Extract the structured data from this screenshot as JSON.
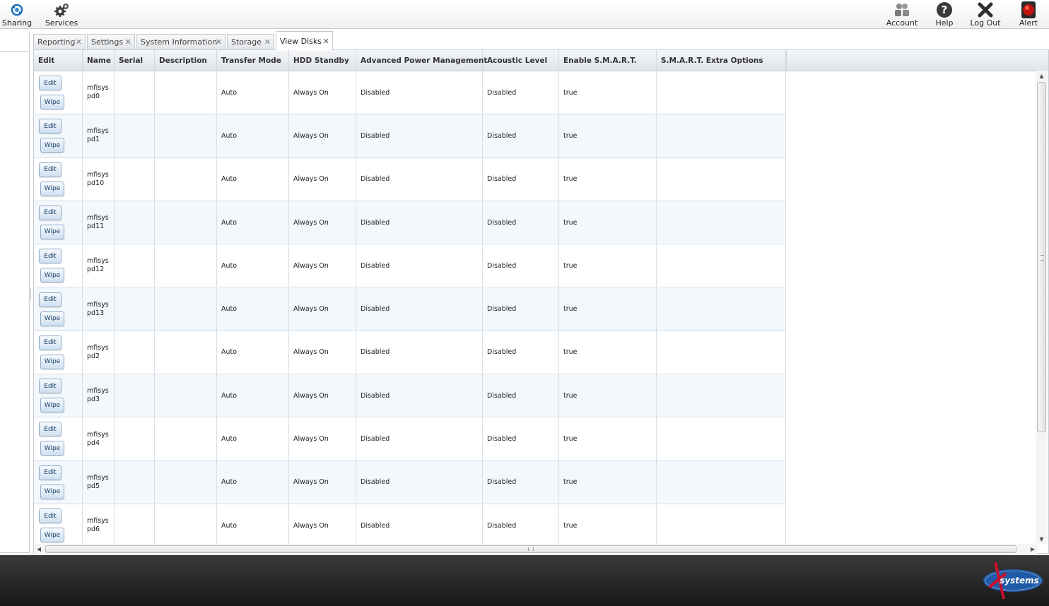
{
  "toolbar": {
    "left": [
      {
        "label": "Sharing",
        "icon": "sharing-icon"
      },
      {
        "label": "Services",
        "icon": "services-icon"
      }
    ],
    "right": [
      {
        "label": "Account",
        "icon": "account-icon"
      },
      {
        "label": "Help",
        "icon": "help-icon"
      },
      {
        "label": "Log Out",
        "icon": "logout-icon"
      },
      {
        "label": "Alert",
        "icon": "alert-icon"
      }
    ]
  },
  "tabs": [
    {
      "label": "Reporting",
      "active": false
    },
    {
      "label": "Settings",
      "active": false
    },
    {
      "label": "System Information",
      "active": false
    },
    {
      "label": "Storage",
      "active": false
    },
    {
      "label": "View Disks",
      "active": true
    }
  ],
  "grid": {
    "columns": [
      "Edit",
      "Name",
      "Serial",
      "Description",
      "Transfer Mode",
      "HDD Standby",
      "Advanced Power Management",
      "Acoustic Level",
      "Enable S.M.A.R.T.",
      "S.M.A.R.T. Extra Options"
    ],
    "edit_label": "Edit",
    "wipe_label": "Wipe",
    "rows": [
      {
        "name": "mfisyspd0",
        "serial": "",
        "description": "",
        "transfer_mode": "Auto",
        "hdd_standby": "Always On",
        "apm": "Disabled",
        "acoustic": "Disabled",
        "smart": "true",
        "smart_extra": ""
      },
      {
        "name": "mfisyspd1",
        "serial": "",
        "description": "",
        "transfer_mode": "Auto",
        "hdd_standby": "Always On",
        "apm": "Disabled",
        "acoustic": "Disabled",
        "smart": "true",
        "smart_extra": ""
      },
      {
        "name": "mfisyspd10",
        "serial": "",
        "description": "",
        "transfer_mode": "Auto",
        "hdd_standby": "Always On",
        "apm": "Disabled",
        "acoustic": "Disabled",
        "smart": "true",
        "smart_extra": ""
      },
      {
        "name": "mfisyspd11",
        "serial": "",
        "description": "",
        "transfer_mode": "Auto",
        "hdd_standby": "Always On",
        "apm": "Disabled",
        "acoustic": "Disabled",
        "smart": "true",
        "smart_extra": ""
      },
      {
        "name": "mfisyspd12",
        "serial": "",
        "description": "",
        "transfer_mode": "Auto",
        "hdd_standby": "Always On",
        "apm": "Disabled",
        "acoustic": "Disabled",
        "smart": "true",
        "smart_extra": ""
      },
      {
        "name": "mfisyspd13",
        "serial": "",
        "description": "",
        "transfer_mode": "Auto",
        "hdd_standby": "Always On",
        "apm": "Disabled",
        "acoustic": "Disabled",
        "smart": "true",
        "smart_extra": ""
      },
      {
        "name": "mfisyspd2",
        "serial": "",
        "description": "",
        "transfer_mode": "Auto",
        "hdd_standby": "Always On",
        "apm": "Disabled",
        "acoustic": "Disabled",
        "smart": "true",
        "smart_extra": ""
      },
      {
        "name": "mfisyspd3",
        "serial": "",
        "description": "",
        "transfer_mode": "Auto",
        "hdd_standby": "Always On",
        "apm": "Disabled",
        "acoustic": "Disabled",
        "smart": "true",
        "smart_extra": ""
      },
      {
        "name": "mfisyspd4",
        "serial": "",
        "description": "",
        "transfer_mode": "Auto",
        "hdd_standby": "Always On",
        "apm": "Disabled",
        "acoustic": "Disabled",
        "smart": "true",
        "smart_extra": ""
      },
      {
        "name": "mfisyspd5",
        "serial": "",
        "description": "",
        "transfer_mode": "Auto",
        "hdd_standby": "Always On",
        "apm": "Disabled",
        "acoustic": "Disabled",
        "smart": "true",
        "smart_extra": ""
      },
      {
        "name": "mfisyspd6",
        "serial": "",
        "description": "",
        "transfer_mode": "Auto",
        "hdd_standby": "Always On",
        "apm": "Disabled",
        "acoustic": "Disabled",
        "smart": "true",
        "smart_extra": ""
      }
    ]
  },
  "footer": {
    "logo_text": "systems",
    "logo_icon": "ixsystems-logo"
  },
  "colors": {
    "row_alt": "#f2f8fc",
    "button_text": "#1a3f66",
    "footer": "#222222",
    "logo_red": "#c8102e",
    "logo_blue": "#1f5aa6"
  }
}
